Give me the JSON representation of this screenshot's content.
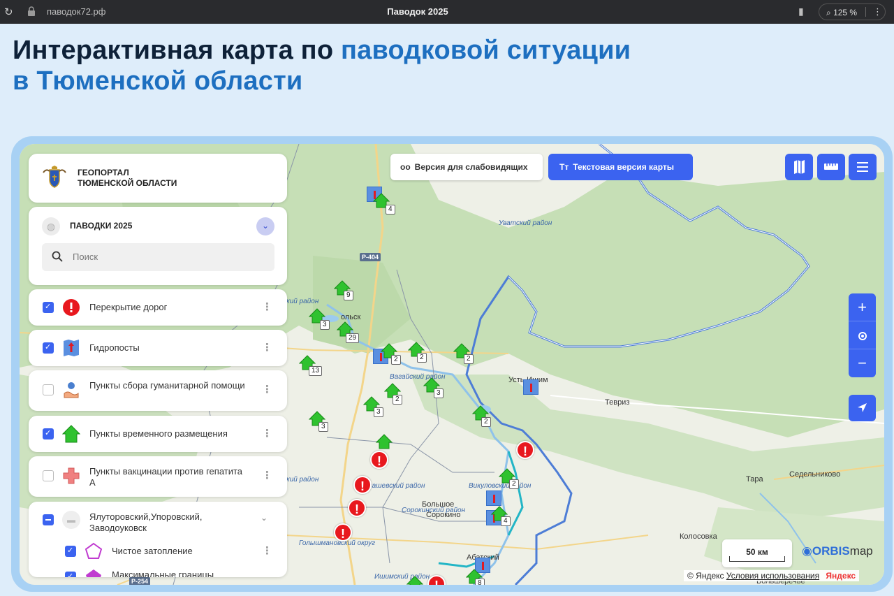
{
  "browser": {
    "url": "паводок72.рф",
    "tab_title": "Паводок 2025",
    "zoom": "125 %"
  },
  "heading": {
    "line1_plain": "Интерактивная карта по ",
    "line1_accent": "паводковой ситуации",
    "line2_accent": "в Тюменской области"
  },
  "controls": {
    "low_vision_label": "Версия для слабовидящих",
    "text_version_label": "Текстовая версия карты",
    "zoom_in": "+",
    "zoom_out": "−"
  },
  "panel": {
    "org_line1": "ГЕОПОРТАЛ",
    "org_line2": "ТЮМЕНСКОЙ ОБЛАСТИ",
    "project_title": "ПАВОДКИ 2025",
    "search_placeholder": "Поиск",
    "layers": [
      {
        "label": "Перекрытие дорог",
        "checked": true,
        "icon": "road-closure-icon"
      },
      {
        "label": "Гидропосты",
        "checked": true,
        "icon": "hydropost-icon"
      },
      {
        "label": "Пункты сбора гуманитарной помощи",
        "checked": false,
        "icon": "aid-collection-icon"
      },
      {
        "label": "Пункты временного размещения",
        "checked": true,
        "icon": "shelter-house-icon"
      },
      {
        "label": "Пункты вакцинации против гепатита А",
        "checked": false,
        "icon": "medical-cross-icon"
      },
      {
        "label": "Ялуторовский,Упоровский, Заводоуковск",
        "checked": "partial",
        "icon": "folder-icon"
      }
    ],
    "sublayers": [
      {
        "label": "Чистое затопление",
        "checked": true
      },
      {
        "label": "Максимальные границы",
        "checked": true
      }
    ]
  },
  "map": {
    "scale_label": "50 км",
    "brand": {
      "prefix": "ORBIS",
      "suffix": "map"
    },
    "copyright": "© Яндекс",
    "terms": "Условия использования",
    "yandex": "Яндекс",
    "labels": {
      "uvat": "Уватский район",
      "vagay": "Вагайский район",
      "aromash": "Аромашевский район",
      "sorokino_district": "Сорокинский район",
      "vikulovo_district": "Викуловский район",
      "golyshmanovo": "Голышмановский округ",
      "ishim": "Ишимский район",
      "abatsky": "Абатский",
      "district_left": "кий район",
      "city_left": "кий район",
      "ust_ishim": "Усть-Ишим",
      "tevriz": "Тевриз",
      "tara": "Тара",
      "sedelnikovo": "Седельниково",
      "kolosovka": "Колосовка",
      "bolshoe": "Большое",
      "sorokino": "Сорокино",
      "vikulovo": "Викулово",
      "tobolsk": "ольск",
      "bolsherechye": "Большеречье",
      "r404": "Р-404",
      "r254": "Р-254",
      "tara_river": "Тара"
    },
    "shelter_counts": [
      "4",
      "9",
      "3",
      "29",
      "13",
      "2",
      "2",
      "2",
      "3",
      "2",
      "3",
      "3",
      "2",
      "2",
      "4",
      "8"
    ],
    "colors": {
      "accent": "#3b63f0",
      "alert": "#e8181e",
      "shelter": "#2fc22f",
      "border": "#4d7dd6"
    }
  }
}
